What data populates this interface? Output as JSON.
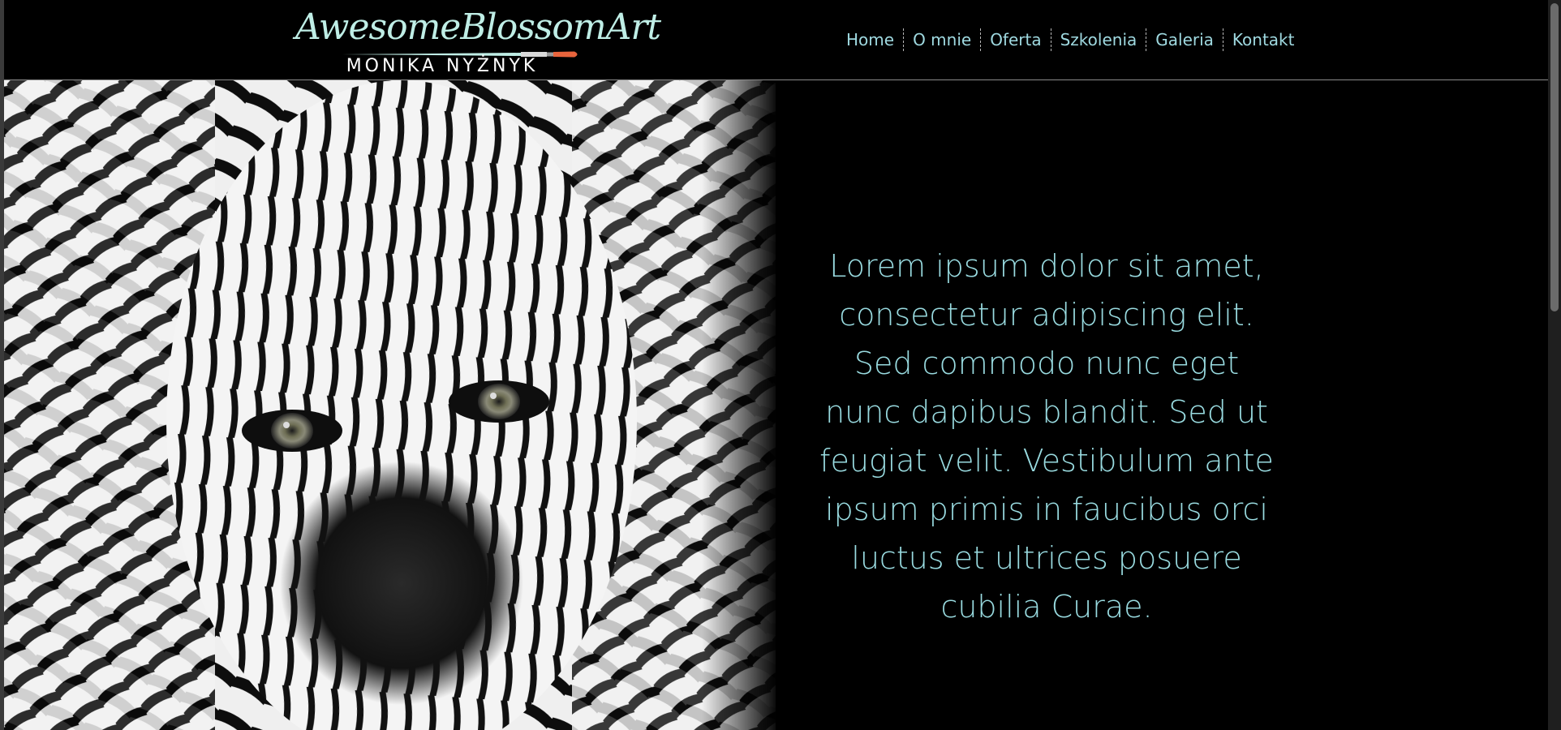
{
  "brand": {
    "title": "AwesomeBlossomArt",
    "subtitle": "MONIKA NYŻNYK",
    "title_color": "#bfeee6",
    "brush_tip_color": "#e8643c"
  },
  "nav": {
    "items": [
      {
        "label": "Home"
      },
      {
        "label": "O mnie"
      },
      {
        "label": "Oferta"
      },
      {
        "label": "Szkolenia"
      },
      {
        "label": "Galeria"
      },
      {
        "label": "Kontakt"
      }
    ],
    "link_color": "#9fd9e0"
  },
  "hero": {
    "image_icon": "zebra-facepaint-photo",
    "text": "Lorem ipsum dolor sit amet, consectetur adipiscing elit. Sed commodo nunc eget nunc dapibus blandit. Sed ut feugiat velit. Vestibulum ante ipsum primis in faucibus orci luctus et ultrices posuere cubilia Curae.",
    "text_color": "#99dbe0"
  },
  "colors": {
    "background": "#000000",
    "header_border": "#8a8a8a"
  }
}
